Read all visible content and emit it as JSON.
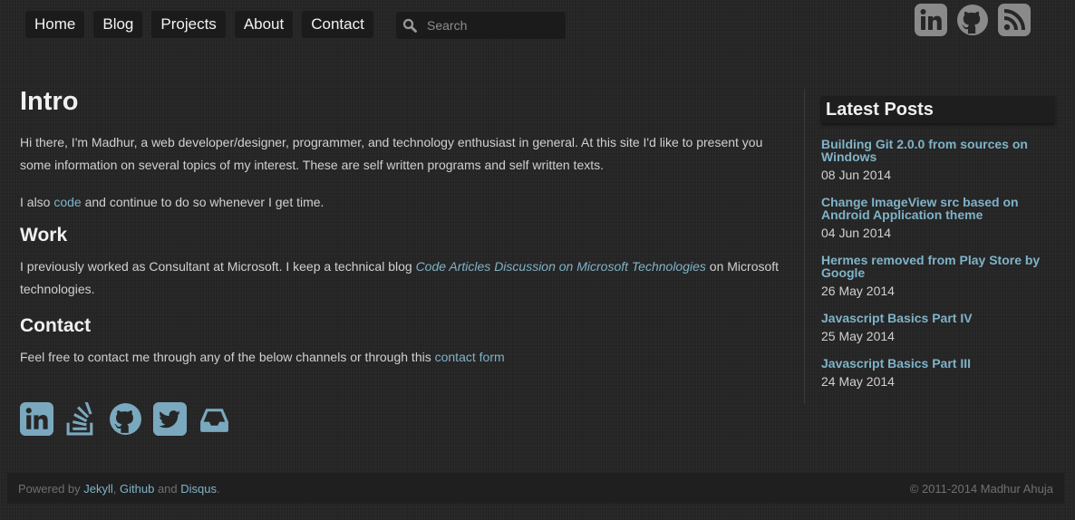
{
  "nav": {
    "items": [
      "Home",
      "Blog",
      "Projects",
      "About",
      "Contact"
    ],
    "search_placeholder": "Search"
  },
  "top_social_icons": [
    "linkedin-icon",
    "github-icon",
    "rss-icon"
  ],
  "main": {
    "intro_heading": "Intro",
    "intro_text": "Hi there, I'm Madhur, a web developer/designer, programmer, and technology enthusiast in general. At this site I'd like to present you some information on several topics of my interest. These are self written programs and self written texts.",
    "code_prefix": "I also ",
    "code_link": "code",
    "code_suffix": " and continue to do so whenever I get time.",
    "work_heading": "Work",
    "work_prefix": "I previously worked as Consultant at Microsoft. I keep a technical blog ",
    "work_link": "Code Articles Discussion on Microsoft Technologies",
    "work_suffix": " on Microsoft technologies.",
    "contact_heading": "Contact",
    "contact_prefix": "Feel free to contact me through any of the below channels or through this ",
    "contact_link": "contact form"
  },
  "bottom_social_icons": [
    "linkedin-icon",
    "stackoverflow-icon",
    "github-icon",
    "twitter-icon",
    "inbox-icon"
  ],
  "sidebar": {
    "heading": "Latest Posts",
    "posts": [
      {
        "title": "Building Git 2.0.0 from sources on Windows",
        "date": "08 Jun 2014"
      },
      {
        "title": "Change ImageView src based on Android Application theme",
        "date": "04 Jun 2014"
      },
      {
        "title": "Hermes removed from Play Store by Google",
        "date": "26 May 2014"
      },
      {
        "title": "Javascript Basics Part IV",
        "date": "25 May 2014"
      },
      {
        "title": "Javascript Basics Part III",
        "date": "24 May 2014"
      }
    ]
  },
  "footer": {
    "powered_prefix": "Powered by ",
    "jekyll": "Jekyll",
    "sep1": ", ",
    "github": "Github",
    "and": " and ",
    "disqus": "Disqus",
    "period": ".",
    "copyright": "© 2011-2014 Madhur Ahuja"
  },
  "colors": {
    "background": "#262626",
    "link": "#7fb3c8",
    "icon_gray": "#8a8a8a",
    "icon_blue": "#7aa9bf"
  }
}
